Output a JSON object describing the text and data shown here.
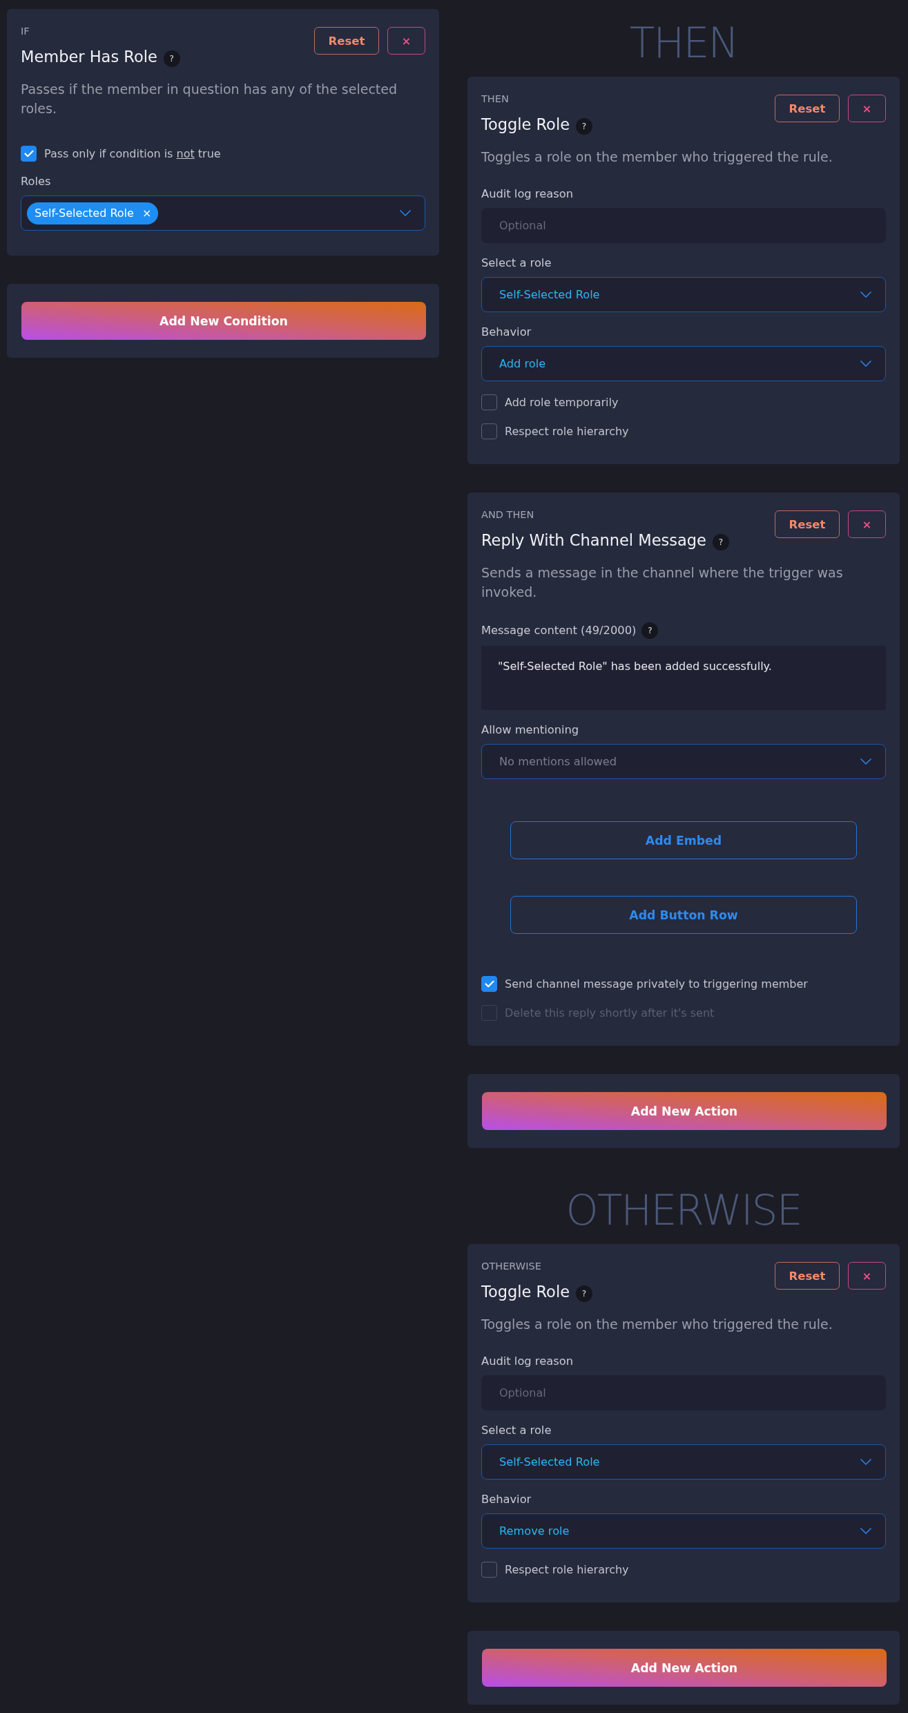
{
  "condition_column": {
    "sections": [
      {
        "cards": [
          {
            "eyebrow": "IF",
            "title": "Member Has Role",
            "help": "?",
            "reset": "Reset",
            "close": "×",
            "description": "Passes if the member in question has any of the selected roles.",
            "fields": [
              {
                "kind": "checkbox",
                "label": "Pass only if condition is *not* true",
                "checked": true,
                "disabled": false
              },
              {
                "kind": "multiselect",
                "label": "Roles",
                "chips": [
                  {
                    "text": "Self-Selected Role",
                    "remove": "×"
                  }
                ]
              }
            ]
          }
        ],
        "add_button": "Add New Condition"
      }
    ]
  },
  "action_column": {
    "sections": [
      {
        "heading": "THEN",
        "cards": [
          {
            "eyebrow": "THEN",
            "title": "Toggle Role",
            "help": "?",
            "reset": "Reset",
            "close": "×",
            "description": "Toggles a role on the member who triggered the rule.",
            "fields": [
              {
                "kind": "input",
                "label": "Audit log reason",
                "placeholder": "Optional"
              },
              {
                "kind": "select",
                "label": "Select a role",
                "value": "Self-Selected Role"
              },
              {
                "kind": "select",
                "label": "Behavior",
                "value": "Add role"
              },
              {
                "kind": "checkbox",
                "label": "Add role temporarily",
                "checked": false,
                "disabled": false
              },
              {
                "kind": "checkbox",
                "label": "Respect role hierarchy",
                "checked": false,
                "disabled": false
              }
            ]
          },
          {
            "eyebrow": "AND THEN",
            "title": "Reply With Channel Message",
            "help": "?",
            "reset": "Reset",
            "close": "×",
            "description": "Sends a message in the channel where the trigger was invoked.",
            "fields": [
              {
                "kind": "textarea",
                "label": "Message content (49/2000)",
                "help": "?",
                "value": "\"Self-Selected Role\" has been added successfully."
              },
              {
                "kind": "select",
                "label": "Allow mentioning",
                "placeholder": "No mentions allowed"
              },
              {
                "kind": "button",
                "label": "Add Embed"
              },
              {
                "kind": "button",
                "label": "Add Button Row"
              },
              {
                "kind": "checkbox",
                "label": "Send channel message privately to triggering member",
                "checked": true,
                "disabled": false
              },
              {
                "kind": "checkbox",
                "label": "Delete this reply shortly after it's sent",
                "checked": false,
                "disabled": true
              }
            ]
          }
        ],
        "add_button": "Add New Action"
      },
      {
        "heading": "OTHERWISE",
        "cards": [
          {
            "eyebrow": "OTHERWISE",
            "title": "Toggle Role",
            "help": "?",
            "reset": "Reset",
            "close": "×",
            "description": "Toggles a role on the member who triggered the rule.",
            "fields": [
              {
                "kind": "input",
                "label": "Audit log reason",
                "placeholder": "Optional"
              },
              {
                "kind": "select",
                "label": "Select a role",
                "value": "Self-Selected Role"
              },
              {
                "kind": "select",
                "label": "Behavior",
                "value": "Remove role"
              },
              {
                "kind": "checkbox",
                "label": "Respect role hierarchy",
                "checked": false,
                "disabled": false
              }
            ]
          }
        ],
        "add_button": "Add New Action"
      }
    ]
  }
}
